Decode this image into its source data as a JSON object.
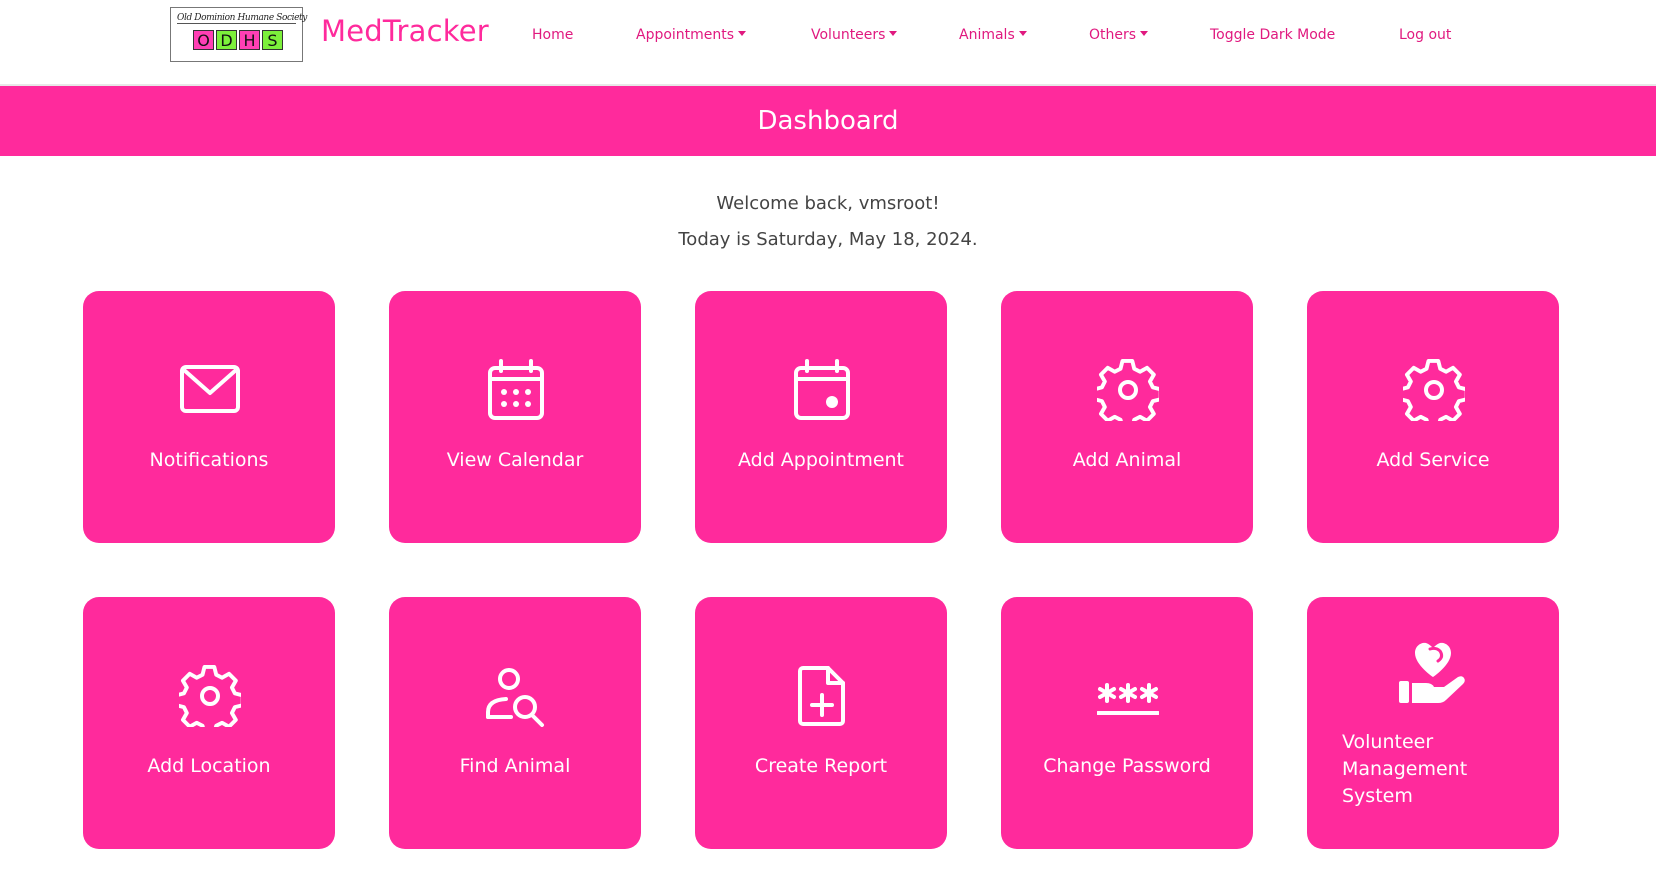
{
  "logo": {
    "top_text": "Old Dominion Humane Society",
    "letters": [
      "O",
      "D",
      "H",
      "S"
    ],
    "letter_colors": [
      "#ff3fb4",
      "#7cf03b",
      "#ff3fb4",
      "#7cf03b"
    ]
  },
  "brand": "MedTracker",
  "nav": {
    "home": "Home",
    "appointments": "Appointments",
    "volunteers": "Volunteers",
    "animals": "Animals",
    "others": "Others",
    "dark_mode": "Toggle Dark Mode",
    "logout": "Log out"
  },
  "banner": {
    "title": "Dashboard"
  },
  "welcome": {
    "greeting": "Welcome back, vmsroot!",
    "date": "Today is Saturday, May 18, 2024."
  },
  "cards": [
    {
      "label": "Notifications",
      "icon": "envelope-icon"
    },
    {
      "label": "View Calendar",
      "icon": "calendar-icon"
    },
    {
      "label": "Add Appointment",
      "icon": "calendar-event-icon"
    },
    {
      "label": "Add Animal",
      "icon": "gear-icon"
    },
    {
      "label": "Add Service",
      "icon": "gear-icon"
    },
    {
      "label": "Add Location",
      "icon": "gear-icon"
    },
    {
      "label": "Find Animal",
      "icon": "person-search-icon"
    },
    {
      "label": "Create Report",
      "icon": "file-plus-icon"
    },
    {
      "label": "Change Password",
      "icon": "password-icon"
    },
    {
      "label": "Volunteer Management System",
      "icon": "hand-heart-icon"
    }
  ],
  "colors": {
    "accent": "#ff2a9c",
    "nav_text": "#e0197f",
    "text": "#444444"
  }
}
